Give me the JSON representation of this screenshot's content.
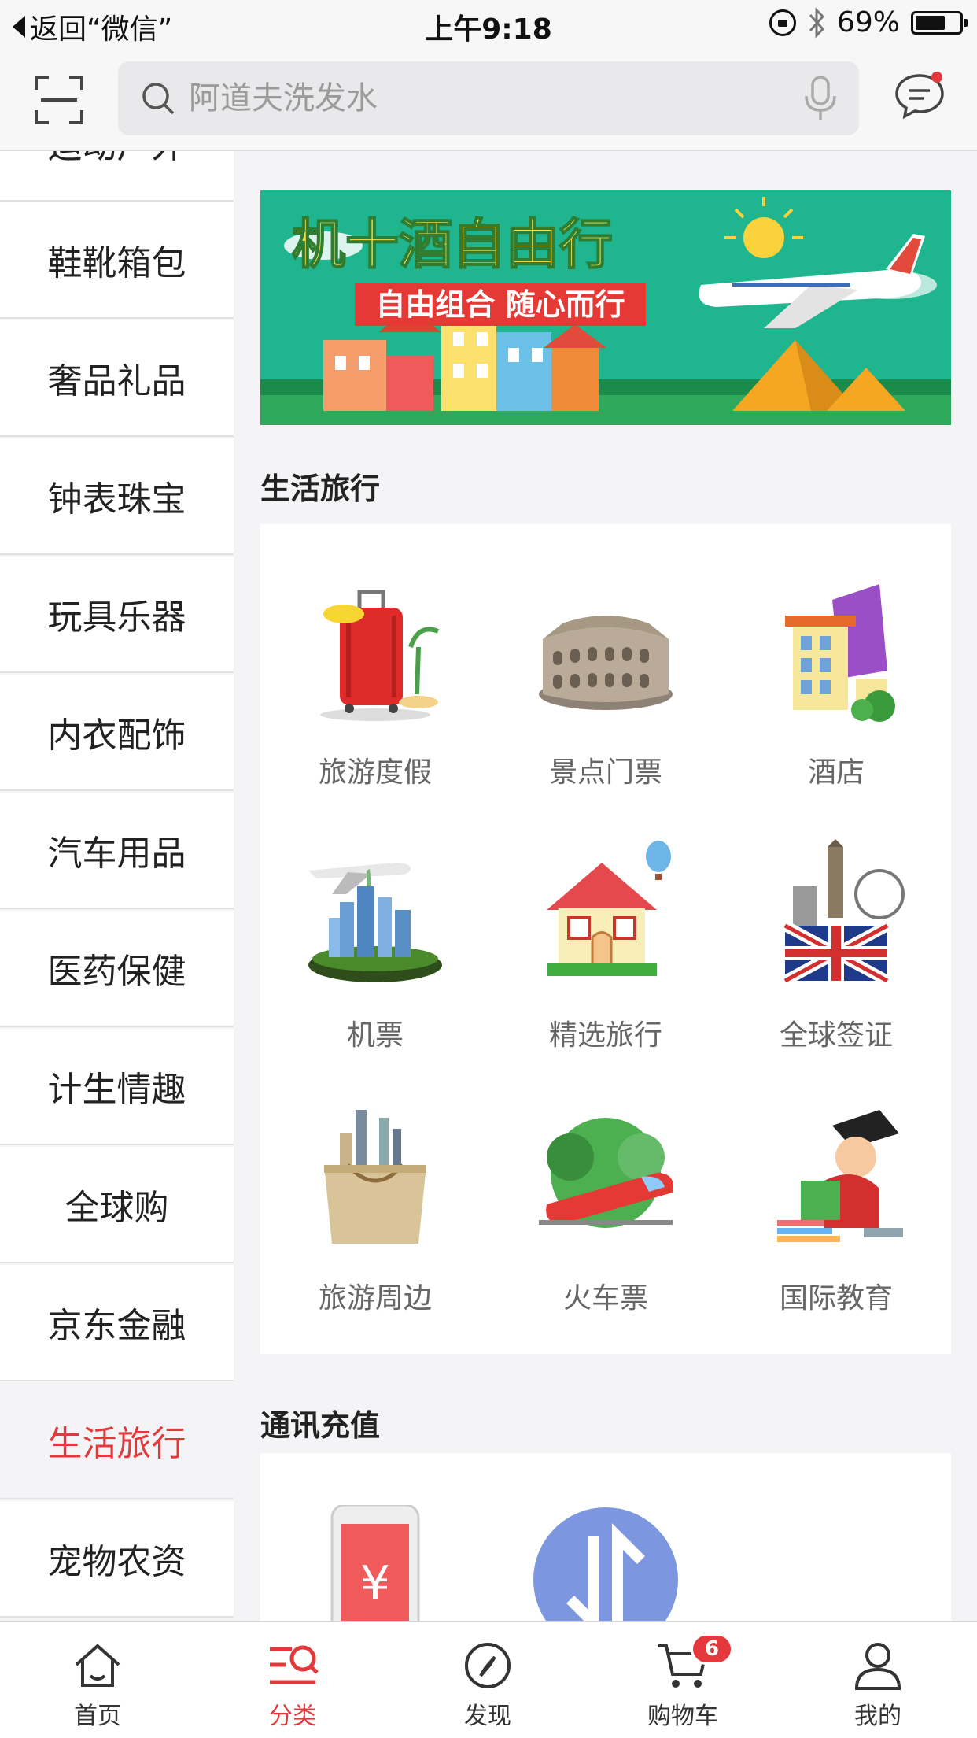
{
  "status_bar": {
    "back_label": "返回“微信”",
    "time": "上午9:18",
    "battery": "69%",
    "battery_level": 0.69
  },
  "search": {
    "placeholder": "阿道夫洗发水"
  },
  "sidebar": {
    "items": [
      {
        "label": "运动户外"
      },
      {
        "label": "鞋靴箱包"
      },
      {
        "label": "奢品礼品"
      },
      {
        "label": "钟表珠宝"
      },
      {
        "label": "玩具乐器"
      },
      {
        "label": "内衣配饰"
      },
      {
        "label": "汽车用品"
      },
      {
        "label": "医药保健"
      },
      {
        "label": "计生情趣"
      },
      {
        "label": "全球购"
      },
      {
        "label": "京东金融"
      },
      {
        "label": "生活旅行",
        "active": true
      },
      {
        "label": "宠物农资"
      }
    ]
  },
  "banner": {
    "title": "机十酒自由行",
    "subtitle": "自由组合 随心而行"
  },
  "sections": [
    {
      "title": "生活旅行",
      "items": [
        {
          "label": "旅游度假",
          "icon": "suitcase-icon"
        },
        {
          "label": "景点门票",
          "icon": "colosseum-icon"
        },
        {
          "label": "酒店",
          "icon": "hotel-icon"
        },
        {
          "label": "机票",
          "icon": "airplane-city-icon"
        },
        {
          "label": "精选旅行",
          "icon": "house-balloon-icon"
        },
        {
          "label": "全球签证",
          "icon": "visa-london-icon"
        },
        {
          "label": "旅游周边",
          "icon": "travel-bag-icon"
        },
        {
          "label": "火车票",
          "icon": "train-icon"
        },
        {
          "label": "国际教育",
          "icon": "graduate-icon"
        }
      ]
    },
    {
      "title": "通讯充值",
      "items": [
        {
          "label": "",
          "icon": "phone-recharge-icon"
        },
        {
          "label": "",
          "icon": "data-transfer-icon"
        }
      ]
    }
  ],
  "tabbar": {
    "tabs": [
      {
        "label": "首页",
        "icon": "home-icon"
      },
      {
        "label": "分类",
        "icon": "category-icon",
        "active": true
      },
      {
        "label": "发现",
        "icon": "compass-icon"
      },
      {
        "label": "购物车",
        "icon": "cart-icon",
        "badge": "6"
      },
      {
        "label": "我的",
        "icon": "user-icon"
      }
    ]
  },
  "colors": {
    "accent": "#e4393c",
    "banner_bg": "#1fb58e",
    "banner_title": "#f9e14b"
  }
}
